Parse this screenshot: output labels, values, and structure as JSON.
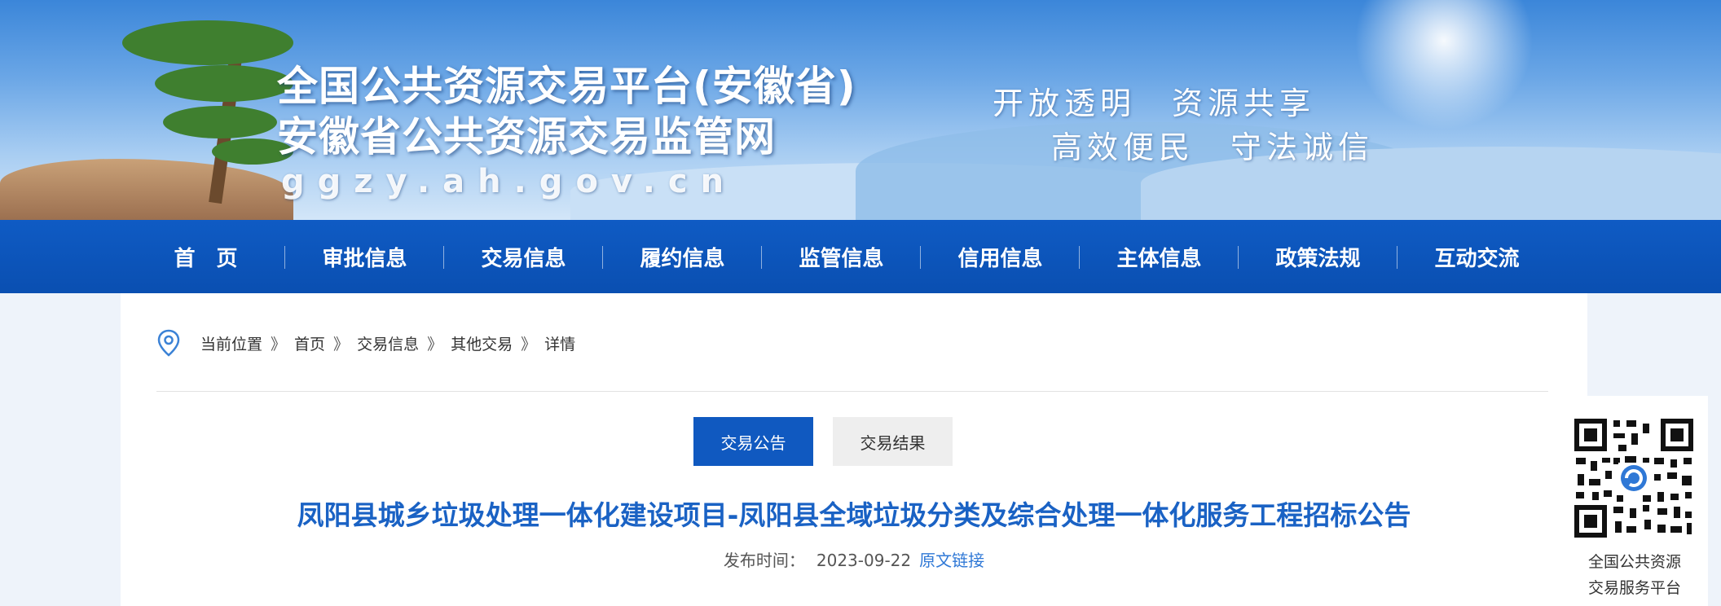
{
  "header": {
    "title_line1": "全国公共资源交易平台(安徽省)",
    "title_line2": "安徽省公共资源交易监管网",
    "url": "ggzy.ah.gov.cn",
    "slogan_line1": "开放透明　资源共享",
    "slogan_line2": "高效便民　守法诚信"
  },
  "nav": {
    "items": [
      "首　页",
      "审批信息",
      "交易信息",
      "履约信息",
      "监管信息",
      "信用信息",
      "主体信息",
      "政策法规",
      "互动交流"
    ]
  },
  "breadcrumb": {
    "icon": "location-pin-icon",
    "items": [
      "当前位置",
      "首页",
      "交易信息",
      "其他交易",
      "详情"
    ],
    "separator": "》"
  },
  "tabs": {
    "announcement": "交易公告",
    "result": "交易结果"
  },
  "article": {
    "title": "凤阳县城乡垃圾处理一体化建设项目-凤阳县全域垃圾分类及综合处理一体化服务工程招标公告",
    "publish_label": "发布时间：",
    "publish_date": "2023-09-22",
    "source_link": "原文链接"
  },
  "qr": {
    "icon": "qr-code-icon",
    "caption_line1": "全国公共资源",
    "caption_line2": "交易服务平台"
  },
  "colors": {
    "nav_bg": "#0a4fb1",
    "accent": "#1059c0",
    "title": "#1a62c4",
    "link": "#2f78d6"
  }
}
